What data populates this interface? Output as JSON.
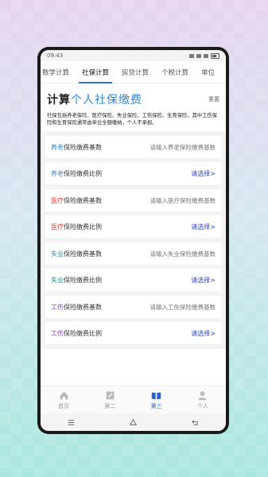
{
  "status": {
    "time": "09:43"
  },
  "tabs": [
    {
      "label": "数学计算"
    },
    {
      "label": "社保计算"
    },
    {
      "label": "房贷计算"
    },
    {
      "label": "个税计算"
    },
    {
      "label": "单位"
    }
  ],
  "header": {
    "title_plain": "计算",
    "title_accent": "个人社保缴费",
    "reset_label": "重置"
  },
  "description": "社保包括养老保险、医疗保险、失业保险、工伤保险、生育保险，其中工伤保险和生育保险通常由单位全额缴纳，个人不承担。",
  "groups": [
    {
      "prefix": "养老",
      "base_label": "保险缴费基数",
      "base_placeholder": "请输入养老保险缴费基数",
      "ratio_label": "保险缴费比例",
      "ratio_action": "请选择>"
    },
    {
      "prefix": "医疗",
      "base_label": "保险缴费基数",
      "base_placeholder": "请输入医疗保险缴费基数",
      "ratio_label": "保险缴费比例",
      "ratio_action": "请选择>"
    },
    {
      "prefix": "失业",
      "base_label": "保险缴费基数",
      "base_placeholder": "请输入失业保险缴费基数",
      "ratio_label": "保险缴费比例",
      "ratio_action": "请选择>"
    },
    {
      "prefix": "工伤",
      "base_label": "保险缴费基数",
      "base_placeholder": "请输入工伤保险缴费基数",
      "ratio_label": "保险缴费比例",
      "ratio_action": "请选择>"
    }
  ],
  "bottom_nav": [
    {
      "label": "首页",
      "icon": "home-icon"
    },
    {
      "label": "第二",
      "icon": "edit-icon"
    },
    {
      "label": "第三",
      "icon": "book-icon"
    },
    {
      "label": "个人",
      "icon": "person-icon"
    }
  ],
  "colors": {
    "accent": "#2f86d6",
    "tab_indicator": "#2f6fe0",
    "select": "#2747c9",
    "nav_active": "#2264c9"
  }
}
